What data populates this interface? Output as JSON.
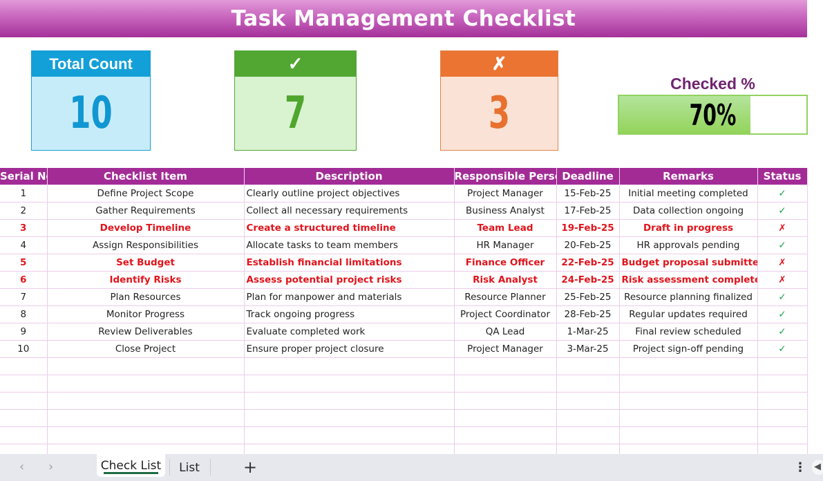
{
  "title": "Task Management Checklist",
  "kpis": {
    "total": {
      "label": "Total Count",
      "value": "10"
    },
    "checked": {
      "label": "✓",
      "value": "7"
    },
    "unchecked": {
      "label": "✗",
      "value": "3"
    },
    "checked_pct": {
      "label": "Checked %",
      "value_text": "70%",
      "fraction": 0.7
    }
  },
  "colors": {
    "banner": "#a5319a",
    "header": "#a22b96",
    "total": "#13a0d8",
    "checked": "#52a733",
    "unchecked": "#eb7433",
    "progress": "#93d45b",
    "highlight_text": "#e0141c",
    "check_mark": "#17a34a"
  },
  "table": {
    "columns": [
      "Serial No.",
      "Checklist Item",
      "Description",
      "Responsible Person",
      "Deadline",
      "Remarks",
      "Status"
    ],
    "rows": [
      {
        "serial": "1",
        "item": "Define Project Scope",
        "description": "Clearly outline project objectives",
        "person": "Project Manager",
        "deadline": "15-Feb-25",
        "remarks": "Initial meeting completed",
        "status": "✓",
        "checked": true
      },
      {
        "serial": "2",
        "item": "Gather Requirements",
        "description": "Collect all necessary requirements",
        "person": "Business Analyst",
        "deadline": "17-Feb-25",
        "remarks": "Data collection ongoing",
        "status": "✓",
        "checked": true
      },
      {
        "serial": "3",
        "item": "Develop Timeline",
        "description": "Create a structured timeline",
        "person": "Team Lead",
        "deadline": "19-Feb-25",
        "remarks": "Draft in progress",
        "status": "✗",
        "checked": false
      },
      {
        "serial": "4",
        "item": "Assign Responsibilities",
        "description": "Allocate tasks to team members",
        "person": "HR Manager",
        "deadline": "20-Feb-25",
        "remarks": "HR approvals pending",
        "status": "✓",
        "checked": true
      },
      {
        "serial": "5",
        "item": "Set Budget",
        "description": "Establish financial limitations",
        "person": "Finance Officer",
        "deadline": "22-Feb-25",
        "remarks": "Budget proposal submitted",
        "status": "✗",
        "checked": false
      },
      {
        "serial": "6",
        "item": "Identify Risks",
        "description": "Assess potential project risks",
        "person": "Risk Analyst",
        "deadline": "24-Feb-25",
        "remarks": "Risk assessment completed",
        "status": "✗",
        "checked": false
      },
      {
        "serial": "7",
        "item": "Plan Resources",
        "description": "Plan for manpower and materials",
        "person": "Resource Planner",
        "deadline": "25-Feb-25",
        "remarks": "Resource planning finalized",
        "status": "✓",
        "checked": true
      },
      {
        "serial": "8",
        "item": "Monitor Progress",
        "description": "Track ongoing progress",
        "person": "Project Coordinator",
        "deadline": "28-Feb-25",
        "remarks": "Regular updates required",
        "status": "✓",
        "checked": true
      },
      {
        "serial": "9",
        "item": "Review Deliverables",
        "description": "Evaluate completed work",
        "person": "QA Lead",
        "deadline": "1-Mar-25",
        "remarks": "Final review scheduled",
        "status": "✓",
        "checked": true
      },
      {
        "serial": "10",
        "item": "Close Project",
        "description": "Ensure proper project closure",
        "person": "Project Manager",
        "deadline": "3-Mar-25",
        "remarks": "Project sign-off pending",
        "status": "✓",
        "checked": true
      }
    ],
    "empty_rows": 6
  },
  "sheet_tabs": {
    "prev": "‹",
    "next": "›",
    "tabs": [
      {
        "label": "Check List",
        "active": true
      },
      {
        "label": "List",
        "active": false
      }
    ],
    "add": "+",
    "more": "⋮",
    "scroll": "◀"
  }
}
